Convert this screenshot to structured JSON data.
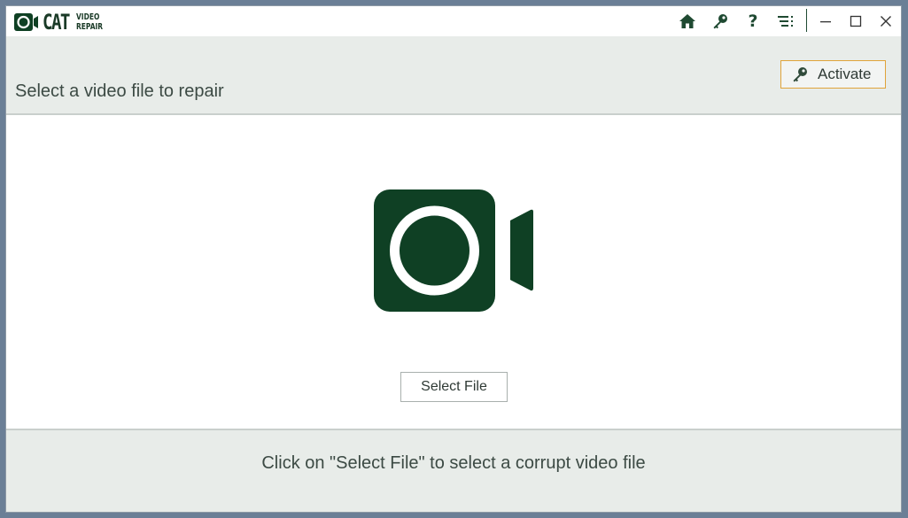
{
  "app": {
    "logo_text": "CAT",
    "logo_sub_line1": "VIDEO",
    "logo_sub_line2": "REPAIR"
  },
  "titlebar": {
    "icons": [
      "home-icon",
      "key-icon",
      "help-icon",
      "menu-icon"
    ],
    "window_controls": [
      "minimize-icon",
      "maximize-icon",
      "close-icon"
    ],
    "help_glyph": "?"
  },
  "header": {
    "title": "Select a video file to repair",
    "activate_label": "Activate"
  },
  "main": {
    "select_file_label": "Select File"
  },
  "footer": {
    "hint": "Click on \"Select File\" to select a corrupt video file"
  },
  "colors": {
    "brand_dark_green": "#0f4024",
    "panel_bg": "#e8ece9",
    "activate_border": "#e0a33a"
  }
}
